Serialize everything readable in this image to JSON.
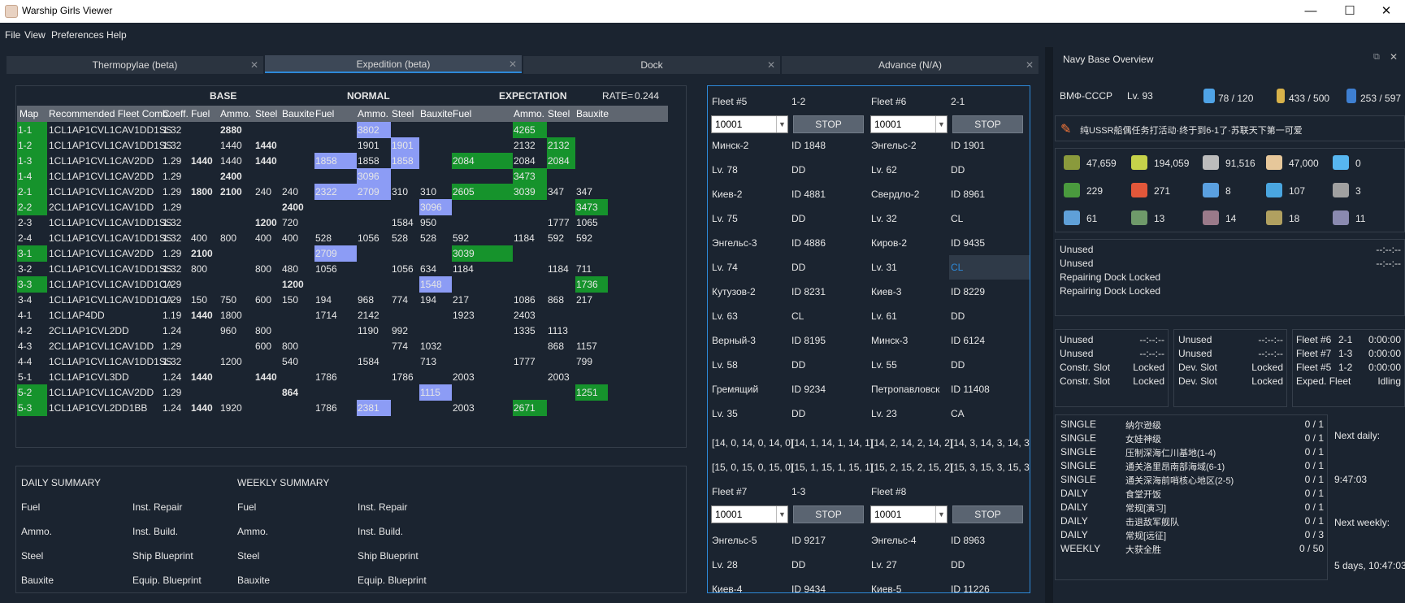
{
  "window": {
    "title": "Warship Girls Viewer",
    "minimize": "—",
    "maximize": "☐",
    "close": "✕"
  },
  "menu": [
    "File",
    "View",
    "Preferences",
    "Help"
  ],
  "tabs": [
    {
      "label": "Thermopylae (beta)",
      "active": false
    },
    {
      "label": "Expedition (beta)",
      "active": true
    },
    {
      "label": "Dock",
      "active": false
    },
    {
      "label": "Advance (N/A)",
      "active": false
    }
  ],
  "expedition": {
    "group_headers": {
      "base": "BASE",
      "normal": "NORMAL",
      "expectation": "EXPECTATION",
      "rate_label": "RATE=",
      "rate_value": "0.244"
    },
    "columns": [
      "Map",
      "Recommended Fleet Comb.",
      "Coeff.",
      "Fuel",
      "Ammo.",
      "Steel",
      "Bauxite",
      "Fuel",
      "Ammo.",
      "Steel",
      "Bauxite",
      "Fuel",
      "Ammo.",
      "Steel",
      "Bauxite"
    ],
    "rows": [
      {
        "map": "1-1",
        "g": true,
        "comb": "1CL1AP1CVL1CAV1DD1SS",
        "coeff": "1.32",
        "cells": [
          "",
          "2880",
          "",
          "",
          "",
          "3802",
          "",
          "",
          "",
          "4265",
          "",
          ""
        ],
        "bold": [
          1
        ],
        "blue": [
          5
        ],
        "green": [
          9
        ]
      },
      {
        "map": "1-2",
        "g": true,
        "comb": "1CL1AP1CVL1CAV1DD1SS",
        "coeff": "1.32",
        "cells": [
          "",
          "1440",
          "1440",
          "",
          "",
          "1901",
          "1901",
          "",
          "",
          "2132",
          "2132",
          ""
        ],
        "bold": [
          2
        ],
        "blue": [
          6
        ],
        "green": [
          10
        ]
      },
      {
        "map": "1-3",
        "g": true,
        "comb": "1CL1AP1CVL1CAV2DD",
        "coeff": "1.29",
        "cells": [
          "1440",
          "1440",
          "1440",
          "",
          "1858",
          "1858",
          "1858",
          "",
          "2084",
          "2084",
          "2084",
          ""
        ],
        "bold": [
          0,
          2
        ],
        "blue": [
          4,
          6
        ],
        "green": [
          8,
          10
        ]
      },
      {
        "map": "1-4",
        "g": true,
        "comb": "1CL1AP1CVL1CAV2DD",
        "coeff": "1.29",
        "cells": [
          "",
          "2400",
          "",
          "",
          "",
          "3096",
          "",
          "",
          "",
          "3473",
          "",
          ""
        ],
        "bold": [
          1
        ],
        "blue": [
          5
        ],
        "green": [
          9
        ]
      },
      {
        "map": "2-1",
        "g": true,
        "comb": "1CL1AP1CVL1CAV2DD",
        "coeff": "1.29",
        "cells": [
          "1800",
          "2100",
          "240",
          "240",
          "2322",
          "2709",
          "310",
          "310",
          "2605",
          "3039",
          "347",
          "347"
        ],
        "bold": [
          0,
          1
        ],
        "blue": [
          4,
          5
        ],
        "green": [
          8,
          9
        ]
      },
      {
        "map": "2-2",
        "g": true,
        "comb": "2CL1AP1CVL1CAV1DD",
        "coeff": "1.29",
        "cells": [
          "",
          "",
          "",
          "2400",
          "",
          "",
          "",
          "3096",
          "",
          "",
          "",
          "3473"
        ],
        "bold": [
          3
        ],
        "blue": [
          7
        ],
        "green": [
          11
        ]
      },
      {
        "map": "2-3",
        "g": false,
        "comb": "1CL1AP1CVL1CAV1DD1SS",
        "coeff": "1.32",
        "cells": [
          "",
          "",
          "1200",
          "720",
          "",
          "",
          "1584",
          "950",
          "",
          "",
          "1777",
          "1065"
        ],
        "bold": [
          2
        ],
        "blue": [],
        "green": []
      },
      {
        "map": "2-4",
        "g": false,
        "comb": "1CL1AP1CVL1CAV1DD1SS",
        "coeff": "1.32",
        "cells": [
          "400",
          "800",
          "400",
          "400",
          "528",
          "1056",
          "528",
          "528",
          "592",
          "1184",
          "592",
          "592"
        ],
        "bold": [],
        "blue": [],
        "green": []
      },
      {
        "map": "3-1",
        "g": true,
        "comb": "1CL1AP1CVL1CAV2DD",
        "coeff": "1.29",
        "cells": [
          "2100",
          "",
          "",
          "",
          "2709",
          "",
          "",
          "",
          "3039",
          "",
          "",
          ""
        ],
        "bold": [
          0
        ],
        "blue": [
          4
        ],
        "green": [
          8
        ]
      },
      {
        "map": "3-2",
        "g": false,
        "comb": "1CL1AP1CVL1CAV1DD1SS",
        "coeff": "1.32",
        "cells": [
          "800",
          "",
          "800",
          "480",
          "1056",
          "",
          "1056",
          "634",
          "1184",
          "",
          "1184",
          "711"
        ],
        "bold": [],
        "blue": [],
        "green": []
      },
      {
        "map": "3-3",
        "g": true,
        "comb": "1CL1AP1CVL1CAV1DD1CA",
        "coeff": "1.29",
        "cells": [
          "",
          "",
          "",
          "1200",
          "",
          "",
          "",
          "1548",
          "",
          "",
          "",
          "1736"
        ],
        "bold": [
          3
        ],
        "blue": [
          7
        ],
        "green": [
          11
        ]
      },
      {
        "map": "3-4",
        "g": false,
        "comb": "1CL1AP1CVL1CAV1DD1CA",
        "coeff": "1.29",
        "cells": [
          "150",
          "750",
          "600",
          "150",
          "194",
          "968",
          "774",
          "194",
          "217",
          "1086",
          "868",
          "217"
        ],
        "bold": [],
        "blue": [],
        "green": []
      },
      {
        "map": "4-1",
        "g": false,
        "comb": "1CL1AP4DD",
        "coeff": "1.19",
        "cells": [
          "1440",
          "1800",
          "",
          "",
          "1714",
          "2142",
          "",
          "",
          "1923",
          "2403",
          "",
          ""
        ],
        "bold": [
          0
        ],
        "blue": [],
        "green": []
      },
      {
        "map": "4-2",
        "g": false,
        "comb": "2CL1AP1CVL2DD",
        "coeff": "1.24",
        "cells": [
          "",
          "960",
          "800",
          "",
          "",
          "1190",
          "992",
          "",
          "",
          "1335",
          "1113",
          ""
        ],
        "bold": [],
        "blue": [],
        "green": []
      },
      {
        "map": "4-3",
        "g": false,
        "comb": "2CL1AP1CVL1CAV1DD",
        "coeff": "1.29",
        "cells": [
          "",
          "",
          "600",
          "800",
          "",
          "",
          "774",
          "1032",
          "",
          "",
          "868",
          "1157"
        ],
        "bold": [],
        "blue": [],
        "green": []
      },
      {
        "map": "4-4",
        "g": false,
        "comb": "1CL1AP1CVL1CAV1DD1SS",
        "coeff": "1.32",
        "cells": [
          "",
          "1200",
          "",
          "540",
          "",
          "1584",
          "",
          "713",
          "",
          "1777",
          "",
          "799"
        ],
        "bold": [],
        "blue": [],
        "green": []
      },
      {
        "map": "5-1",
        "g": false,
        "comb": "1CL1AP1CVL3DD",
        "coeff": "1.24",
        "cells": [
          "1440",
          "",
          "1440",
          "",
          "1786",
          "",
          "1786",
          "",
          "2003",
          "",
          "2003",
          ""
        ],
        "bold": [
          0,
          2
        ],
        "blue": [],
        "green": []
      },
      {
        "map": "5-2",
        "g": true,
        "comb": "1CL1AP1CVL1CAV2DD",
        "coeff": "1.29",
        "cells": [
          "",
          "",
          "",
          "864",
          "",
          "",
          "",
          "1115",
          "",
          "",
          "",
          "1251"
        ],
        "bold": [
          3
        ],
        "blue": [
          7
        ],
        "green": [
          11
        ]
      },
      {
        "map": "5-3",
        "g": true,
        "comb": "1CL1AP1CVL2DD1BB",
        "coeff": "1.24",
        "cells": [
          "1440",
          "1920",
          "",
          "",
          "1786",
          "2381",
          "",
          "",
          "2003",
          "2671",
          "",
          ""
        ],
        "bold": [
          0
        ],
        "blue": [
          5
        ],
        "green": [
          9
        ]
      }
    ]
  },
  "summary": {
    "daily_title": "DAILY SUMMARY",
    "weekly_title": "WEEKLY SUMMARY",
    "col1": [
      "Fuel",
      "Ammo.",
      "Steel",
      "Bauxite"
    ],
    "col2": [
      "Inst. Repair",
      "Inst. Build.",
      "Ship Blueprint",
      "Equip. Blueprint"
    ]
  },
  "fleets": {
    "f5": {
      "name": "Fleet #5",
      "map": "1-2",
      "select": "10001",
      "stop": "STOP",
      "ships": [
        [
          "Минск-2",
          "ID 1848",
          "Lv. 78",
          "DD"
        ],
        [
          "Киев-2",
          "ID 4881",
          "Lv. 75",
          "DD"
        ],
        [
          "Энгельс-3",
          "ID 4886",
          "Lv. 74",
          "DD"
        ],
        [
          "Кутузов-2",
          "ID 8231",
          "Lv. 63",
          "CL"
        ],
        [
          "Верный-3",
          "ID 8195",
          "Lv. 58",
          "DD"
        ],
        [
          "Гремящий",
          "ID 9234",
          "Lv. 35",
          "DD"
        ]
      ],
      "arr1": "[14, 0, 14, 0, 14, 0]",
      "arr2": "[14, 1, 14, 1, 14, 1]"
    },
    "f6": {
      "name": "Fleet #6",
      "map": "2-1",
      "select": "10001",
      "stop": "STOP",
      "ships": [
        [
          "Энгельс-2",
          "ID 1901",
          "Lv. 62",
          "DD"
        ],
        [
          "Свердло-2",
          "ID 8961",
          "Lv. 32",
          "CL"
        ],
        [
          "Киров-2",
          "ID 9435",
          "Lv. 31",
          "CL"
        ],
        [
          "Киев-3",
          "ID 8229",
          "Lv. 61",
          "DD"
        ],
        [
          "Минск-3",
          "ID 6124",
          "Lv. 55",
          "DD"
        ],
        [
          "Петропавловск",
          "ID 11408",
          "Lv. 23",
          "CA"
        ]
      ],
      "arr1": "[14, 2, 14, 2, 14, 2]",
      "arr2": "[14, 3, 14, 3, 14, 3]"
    },
    "arr_row2": [
      "[15, 0, 15, 0, 15, 0]",
      "[15, 1, 15, 1, 15, 1]",
      "[15, 2, 15, 2, 15, 2]",
      "[15, 3, 15, 3, 15, 3]"
    ],
    "f7": {
      "name": "Fleet #7",
      "map": "1-3",
      "select": "10001",
      "stop": "STOP",
      "ships": [
        [
          "Энгельс-5",
          "ID 9217",
          "Lv. 28",
          "DD"
        ],
        [
          "Киев-4",
          "ID 9434"
        ]
      ]
    },
    "f8": {
      "name": "Fleet #8",
      "map": "",
      "select": "10001",
      "stop": "STOP",
      "ships": [
        [
          "Энгельс-4",
          "ID 8963",
          "Lv. 27",
          "DD"
        ],
        [
          "Киев-5",
          "ID 11226"
        ]
      ]
    }
  },
  "navy": {
    "title": "Navy Base Overview",
    "nick": "ВМФ-СССР",
    "level": "Lv. 93",
    "ships": "78 / 120",
    "equips": "433 / 500",
    "cards": "253 / 597",
    "signature": "纯USSR船偶任务打活动·终于到6-1了·苏联天下第一可爱",
    "res1": [
      "47,659",
      "194,059",
      "91,516",
      "47,000",
      "0"
    ],
    "res2": [
      "229",
      "271",
      "8",
      "107",
      "3"
    ],
    "res3": [
      "61",
      "13",
      "14",
      "18",
      "11"
    ],
    "repair": [
      [
        "Unused",
        "--:--:--"
      ],
      [
        "Unused",
        "--:--:--"
      ],
      [
        "Repairing Dock Locked",
        ""
      ],
      [
        "Repairing Dock Locked",
        ""
      ]
    ],
    "build": [
      [
        "Unused",
        "--:--:--"
      ],
      [
        "Unused",
        "--:--:--"
      ],
      [
        "Constr. Slot",
        "Locked"
      ],
      [
        "Constr. Slot",
        "Locked"
      ]
    ],
    "dev": [
      [
        "Unused",
        "--:--:--"
      ],
      [
        "Unused",
        "--:--:--"
      ],
      [
        "Dev. Slot",
        "Locked"
      ],
      [
        "Dev. Slot",
        "Locked"
      ]
    ],
    "exped": [
      [
        "Fleet #6",
        "2-1",
        "0:00:00"
      ],
      [
        "Fleet #7",
        "1-3",
        "0:00:00"
      ],
      [
        "Fleet #5",
        "1-2",
        "0:00:00"
      ],
      [
        "Exped. Fleet",
        "",
        "Idling"
      ]
    ],
    "tasks": [
      [
        "SINGLE",
        "纳尔逊级",
        "0 / 1"
      ],
      [
        "SINGLE",
        "女娃神级",
        "0 / 1"
      ],
      [
        "SINGLE",
        "压制深海仁川基地(1-4)",
        "0 / 1"
      ],
      [
        "SINGLE",
        "通关洛里昂南部海域(6-1)",
        "0 / 1"
      ],
      [
        "SINGLE",
        "通关深海前哨核心地区(2-5)",
        "0 / 1"
      ],
      [
        "DAILY",
        "食堂开饭",
        "0 / 1"
      ],
      [
        "DAILY",
        "常规[演习]",
        "0 / 1"
      ],
      [
        "DAILY",
        "击退敌军舰队",
        "0 / 1"
      ],
      [
        "DAILY",
        "常规[远征]",
        "0 / 3"
      ],
      [
        "WEEKLY",
        "大获全胜",
        "0 / 50"
      ]
    ],
    "next_daily_label": "Next daily:",
    "next_daily": "9:47:03",
    "next_weekly_label": "Next weekly:",
    "next_weekly": "5 days, 10:47:03"
  }
}
